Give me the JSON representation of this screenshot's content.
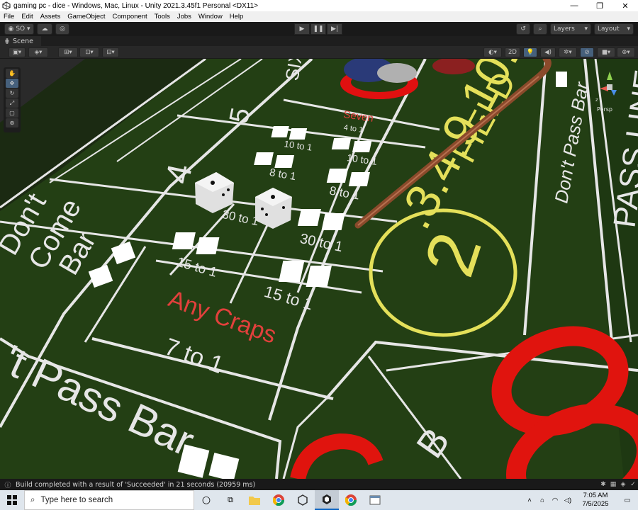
{
  "window": {
    "title": "gaming pc - dice - Windows, Mac, Linux - Unity 2021.3.45f1 Personal <DX11>",
    "controls": {
      "minimize": "—",
      "maximize": "❐",
      "close": "✕"
    }
  },
  "menu": [
    "File",
    "Edit",
    "Assets",
    "GameObject",
    "Component",
    "Tools",
    "Jobs",
    "Window",
    "Help"
  ],
  "toolbar": {
    "account_label": "SO ▾",
    "layers_label": "Layers",
    "layout_label": "Layout",
    "play_icons": [
      "play-icon",
      "pause-icon",
      "step-icon"
    ]
  },
  "scene_tab": {
    "label": "Scene"
  },
  "scene_toolbar": {
    "mode_2d": "2D"
  },
  "viewport": {
    "persp_label": "Persp",
    "table_texts": {
      "six": "SIX",
      "five": "5",
      "four": "4",
      "seven": "Seven",
      "seven_odds": "4 to 1",
      "ten_to_one_a": "10 to 1",
      "ten_to_one_b": "10 to 1",
      "eight_to_one_a": "8 to 1",
      "eight_to_one_b": "8 to 1",
      "thirty_to_one_a": "30 to 1",
      "thirty_to_one_b": "30 to 1",
      "fifteen_to_one_a": "15 to 1",
      "fifteen_to_one_b": "15 to 1",
      "any_craps": "Any Craps",
      "any_craps_odds": "7 to 1",
      "dont_come": "Don't",
      "dont_come_2": "Come",
      "dont_come_3": "Bar",
      "dont_pass_bar": "Don't Pass Bar",
      "pass_line": "PASS LINE",
      "dont_pass_bottom": "'t Pass Bar",
      "field": "FIELD",
      "field_numbers": ".3.4.9.10.1",
      "field_two": "2",
      "big_eight": "8",
      "big_b": "B"
    }
  },
  "status": {
    "message": "Build completed with a result of 'Succeeded' in 21 seconds (20959 ms)"
  },
  "taskbar": {
    "search_placeholder": "Type here to search",
    "time": "7:05 AM",
    "date": "7/5/2025"
  },
  "colors": {
    "felt": "#233f14",
    "felt_dark": "#1b3210",
    "line": "#e6e6e6",
    "field_yellow": "#e4e05a",
    "craps_red": "#e2403c",
    "big_red": "#e0140e",
    "stick": "#8a4a2b"
  }
}
